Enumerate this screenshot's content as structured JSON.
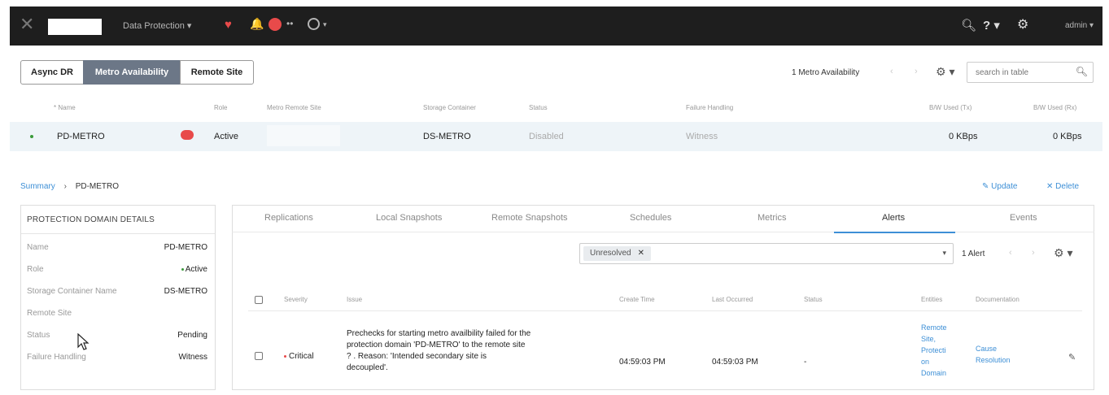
{
  "topbar": {
    "menu_label": "Data Protection ▾",
    "dots": "••",
    "caret": "▾",
    "help_label": "? ▾",
    "user_label": "admin ▾"
  },
  "tabs_top": [
    "Async DR",
    "Metro Availability",
    "Remote Site"
  ],
  "table_controls": {
    "count_label": "1 Metro Availability",
    "prev": "‹",
    "next": "›",
    "gear_caret": "⚙ ▾",
    "search_placeholder": "search in table"
  },
  "table": {
    "columns": [
      "* Name",
      "Role",
      "Metro Remote Site",
      "Storage Container",
      "Status",
      "Failure Handling",
      "B/W Used (Tx)",
      "B/W Used (Rx)"
    ],
    "row": {
      "name": "PD-METRO",
      "role": "Active",
      "remote_site": "",
      "container": "DS-METRO",
      "status": "Disabled",
      "failure_handling": "Witness",
      "bw_tx": "0 KBps",
      "bw_rx": "0 KBps"
    }
  },
  "breadcrumb": {
    "root": "Summary",
    "separator": "›",
    "current": "PD-METRO"
  },
  "actions": {
    "update": "✎ Update",
    "delete": "✕ Delete"
  },
  "details": {
    "title": "PROTECTION DOMAIN DETAILS",
    "items": [
      {
        "key": "Name",
        "value": "PD-METRO"
      },
      {
        "key": "Role",
        "value": "Active"
      },
      {
        "key": "Storage Container Name",
        "value": "DS-METRO"
      },
      {
        "key": "Remote Site",
        "value": ""
      },
      {
        "key": "Status",
        "value": "Pending"
      },
      {
        "key": "Failure Handling",
        "value": "Witness"
      }
    ]
  },
  "detail_tabs": [
    "Replications",
    "Local Snapshots",
    "Remote Snapshots",
    "Schedules",
    "Metrics",
    "Alerts",
    "Events"
  ],
  "alerts": {
    "filter_chip": "Unresolved",
    "chip_close": "✕",
    "caret": "▾",
    "count": "1 Alert",
    "prev": "‹",
    "next": "›",
    "gear_caret": "⚙ ▾",
    "columns": [
      "Severity",
      "Issue",
      "Create Time",
      "Last Occurred",
      "Status",
      "Entities",
      "Documentation"
    ],
    "row": {
      "severity": "Critical",
      "issue_lines": [
        "Prechecks for starting metro availbility failed for the",
        "protection domain 'PD-METRO' to the remote site",
        "?              . Reason: 'Intended secondary site is",
        "decoupled'."
      ],
      "create_time": "04:59:03 PM",
      "last_occurred": "04:59:03 PM",
      "status": "-",
      "entities": [
        "Remote",
        "Site,",
        "Protecti",
        "on",
        "Domain"
      ],
      "documentation": [
        "Cause",
        "Resolution"
      ]
    }
  },
  "colors": {
    "accent": "#3d8fd6",
    "critical": "#e84a4a",
    "active": "#3a9a3a",
    "topbar": "#1e1e1e"
  }
}
